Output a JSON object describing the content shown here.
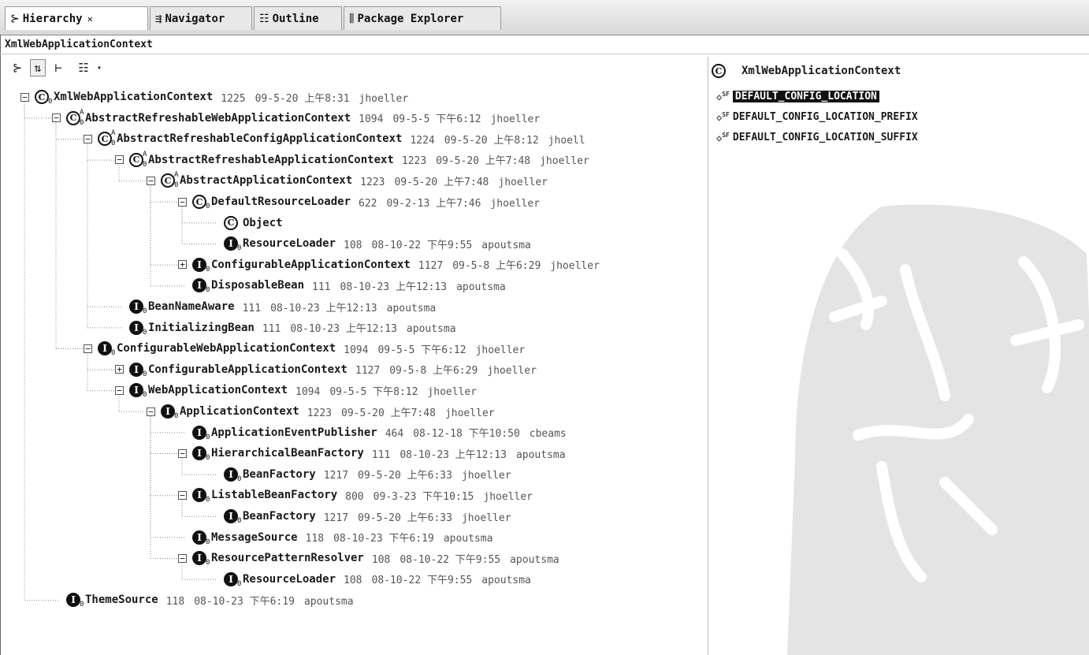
{
  "tabs": [
    {
      "label": "Hierarchy",
      "icon": "hierarchy-icon",
      "active": true,
      "closable": true
    },
    {
      "label": "Navigator",
      "icon": "navigator-icon",
      "active": false
    },
    {
      "label": "Outline",
      "icon": "outline-icon",
      "active": false
    },
    {
      "label": "Package Explorer",
      "icon": "package-explorer-icon",
      "active": false
    }
  ],
  "context_label": "XmlWebApplicationContext",
  "toolbar": {
    "buttons": [
      "type-hierarchy-icon",
      "supertype-hierarchy-icon",
      "subtype-hierarchy-icon",
      "layout-menu-icon"
    ],
    "dropdown": "view-menu-dropdown-icon"
  },
  "tree": [
    {
      "depth": 0,
      "toggle": "minus",
      "kind": "class",
      "sup": "",
      "sub": "0",
      "name": "XmlWebApplicationContext",
      "rev": "1225",
      "date": "09-5-20 上午8:31",
      "author": "jhoeller"
    },
    {
      "depth": 1,
      "toggle": "minus",
      "kind": "class",
      "sup": "A",
      "sub": "0",
      "name": "AbstractRefreshableWebApplicationContext",
      "rev": "1094",
      "date": "09-5-5 下午6:12",
      "author": "jhoeller"
    },
    {
      "depth": 2,
      "toggle": "minus",
      "kind": "class",
      "sup": "A",
      "sub": "0",
      "name": "AbstractRefreshableConfigApplicationContext",
      "rev": "1224",
      "date": "09-5-20 上午8:12",
      "author": "jhoell"
    },
    {
      "depth": 3,
      "toggle": "minus",
      "kind": "class",
      "sup": "A",
      "sub": "0",
      "name": "AbstractRefreshableApplicationContext",
      "rev": "1223",
      "date": "09-5-20 上午7:48",
      "author": "jhoeller"
    },
    {
      "depth": 4,
      "toggle": "minus",
      "kind": "class",
      "sup": "A",
      "sub": "0",
      "name": "AbstractApplicationContext",
      "rev": "1223",
      "date": "09-5-20 上午7:48",
      "author": "jhoeller"
    },
    {
      "depth": 5,
      "toggle": "minus",
      "kind": "class",
      "sup": "",
      "sub": "0",
      "name": "DefaultResourceLoader",
      "rev": "622",
      "date": "09-2-13 上午7:46",
      "author": "jhoeller"
    },
    {
      "depth": 6,
      "toggle": "",
      "kind": "class",
      "sup": "",
      "sub": "",
      "name": "Object",
      "rev": "",
      "date": "",
      "author": ""
    },
    {
      "depth": 6,
      "toggle": "",
      "kind": "interface",
      "sup": "",
      "sub": "0",
      "name": "ResourceLoader",
      "rev": "108",
      "date": "08-10-22 下午9:55",
      "author": "apoutsma"
    },
    {
      "depth": 5,
      "toggle": "plus",
      "kind": "interface",
      "sup": "",
      "sub": "0",
      "name": "ConfigurableApplicationContext",
      "rev": "1127",
      "date": "09-5-8 上午6:29",
      "author": "jhoeller"
    },
    {
      "depth": 5,
      "toggle": "",
      "kind": "interface",
      "sup": "",
      "sub": "0",
      "name": "DisposableBean",
      "rev": "111",
      "date": "08-10-23 上午12:13",
      "author": "apoutsma"
    },
    {
      "depth": 3,
      "toggle": "",
      "kind": "interface",
      "sup": "",
      "sub": "0",
      "name": "BeanNameAware",
      "rev": "111",
      "date": "08-10-23 上午12:13",
      "author": "apoutsma"
    },
    {
      "depth": 3,
      "toggle": "",
      "kind": "interface",
      "sup": "",
      "sub": "0",
      "name": "InitializingBean",
      "rev": "111",
      "date": "08-10-23 上午12:13",
      "author": "apoutsma"
    },
    {
      "depth": 2,
      "toggle": "minus",
      "kind": "interface",
      "sup": "",
      "sub": "0",
      "name": "ConfigurableWebApplicationContext",
      "rev": "1094",
      "date": "09-5-5 下午6:12",
      "author": "jhoeller"
    },
    {
      "depth": 3,
      "toggle": "plus",
      "kind": "interface",
      "sup": "",
      "sub": "0",
      "name": "ConfigurableApplicationContext",
      "rev": "1127",
      "date": "09-5-8 上午6:29",
      "author": "jhoeller"
    },
    {
      "depth": 3,
      "toggle": "minus",
      "kind": "interface",
      "sup": "",
      "sub": "0",
      "name": "WebApplicationContext",
      "rev": "1094",
      "date": "09-5-5 下午8:12",
      "author": "jhoeller"
    },
    {
      "depth": 4,
      "toggle": "minus",
      "kind": "interface",
      "sup": "",
      "sub": "0",
      "name": "ApplicationContext",
      "rev": "1223",
      "date": "09-5-20 上午7:48",
      "author": "jhoeller"
    },
    {
      "depth": 5,
      "toggle": "",
      "kind": "interface",
      "sup": "",
      "sub": "0",
      "name": "ApplicationEventPublisher",
      "rev": "464",
      "date": "08-12-18 下午10:50",
      "author": "cbeams"
    },
    {
      "depth": 5,
      "toggle": "minus",
      "kind": "interface",
      "sup": "",
      "sub": "0",
      "name": "HierarchicalBeanFactory",
      "rev": "111",
      "date": "08-10-23 上午12:13",
      "author": "apoutsma"
    },
    {
      "depth": 6,
      "toggle": "",
      "kind": "interface",
      "sup": "",
      "sub": "0",
      "name": "BeanFactory",
      "rev": "1217",
      "date": "09-5-20 上午6:33",
      "author": "jhoeller"
    },
    {
      "depth": 5,
      "toggle": "minus",
      "kind": "interface",
      "sup": "",
      "sub": "0",
      "name": "ListableBeanFactory",
      "rev": "800",
      "date": "09-3-23 下午10:15",
      "author": "jhoeller"
    },
    {
      "depth": 6,
      "toggle": "",
      "kind": "interface",
      "sup": "",
      "sub": "0",
      "name": "BeanFactory",
      "rev": "1217",
      "date": "09-5-20 上午6:33",
      "author": "jhoeller"
    },
    {
      "depth": 5,
      "toggle": "",
      "kind": "interface",
      "sup": "",
      "sub": "0",
      "name": "MessageSource",
      "rev": "118",
      "date": "08-10-23 下午6:19",
      "author": "apoutsma"
    },
    {
      "depth": 5,
      "toggle": "minus",
      "kind": "interface",
      "sup": "",
      "sub": "0",
      "name": "ResourcePatternResolver",
      "rev": "108",
      "date": "08-10-22 下午9:55",
      "author": "apoutsma"
    },
    {
      "depth": 6,
      "toggle": "",
      "kind": "interface",
      "sup": "",
      "sub": "0",
      "name": "ResourceLoader",
      "rev": "108",
      "date": "08-10-22 下午9:55",
      "author": "apoutsma"
    },
    {
      "depth": 1,
      "toggle": "",
      "kind": "interface",
      "sup": "",
      "sub": "0",
      "name": "ThemeSource",
      "rev": "118",
      "date": "08-10-23 下午6:19",
      "author": "apoutsma"
    }
  ],
  "members_panel": {
    "header": "XmlWebApplicationContext",
    "header_icon": "class-icon",
    "fields": [
      {
        "marker": "SF",
        "name": "DEFAULT_CONFIG_LOCATION",
        "selected": true
      },
      {
        "marker": "SF",
        "name": "DEFAULT_CONFIG_LOCATION_PREFIX",
        "selected": false
      },
      {
        "marker": "SF",
        "name": "DEFAULT_CONFIG_LOCATION_SUFFIX",
        "selected": false
      }
    ]
  }
}
